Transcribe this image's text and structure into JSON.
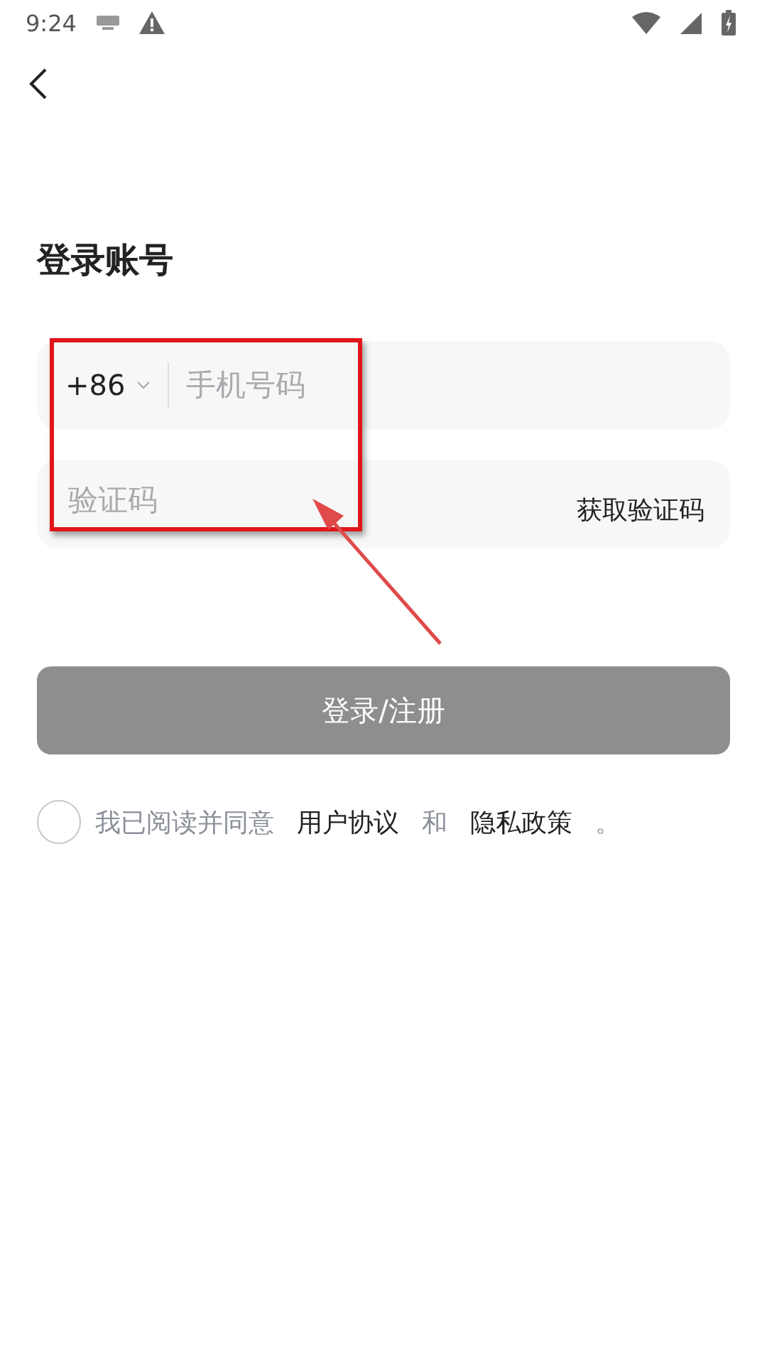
{
  "status_bar": {
    "time": "9:24"
  },
  "title": "登录账号",
  "phone": {
    "country_code": "+86",
    "placeholder": "手机号码"
  },
  "code": {
    "placeholder": "验证码",
    "action": "获取验证码"
  },
  "submit": {
    "label": "登录/注册",
    "disabled": true
  },
  "agreement": {
    "checked": false,
    "parts": [
      {
        "kind": "plain",
        "text": "我已阅读并同意"
      },
      {
        "kind": "link",
        "text": "用户协议"
      },
      {
        "kind": "plain",
        "text": "和"
      },
      {
        "kind": "link",
        "text": "隐私政策"
      },
      {
        "kind": "plain",
        "text": "。"
      }
    ]
  }
}
